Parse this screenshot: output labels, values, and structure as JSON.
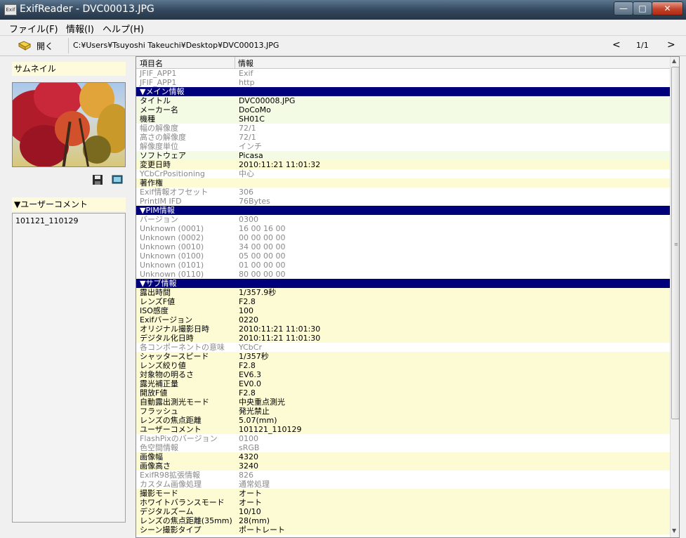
{
  "window": {
    "app_icon": "Exif",
    "title": "ExifReader - DVC00013.JPG",
    "controls": {
      "minimize": "—",
      "maximize": "□",
      "close": "✕"
    }
  },
  "menu": [
    "ファイル(F)",
    "情報(I)",
    "ヘルプ(H)"
  ],
  "toolbar": {
    "open_label": "開く",
    "open_icon": "open-icon",
    "path": "C:¥Users¥Tsuyoshi Takeuchi¥Desktop¥DVC00013.JPG",
    "prev": "<",
    "page": "1/1",
    "next": ">"
  },
  "left": {
    "thumbnail_label": "サムネイル",
    "user_comment_label": "▼ユーザーコメント",
    "user_comment": "101121_110129",
    "icons": [
      "save-icon",
      "monitor-icon"
    ]
  },
  "grid": {
    "header": {
      "col1": "項目名",
      "col2": "情報"
    },
    "rows": [
      {
        "k": "JFIF_APP1",
        "v": "Exif",
        "s": "g"
      },
      {
        "k": "JFIF_APP1",
        "v": "http",
        "s": "g"
      },
      {
        "k": "▼メイン情報",
        "v": "",
        "s": "h"
      },
      {
        "k": "タイトル",
        "v": "DVC00008.JPG",
        "s": "n"
      },
      {
        "k": "メーカー名",
        "v": "DoCoMo",
        "s": "n"
      },
      {
        "k": "機種",
        "v": "SH01C",
        "s": "n"
      },
      {
        "k": "幅の解像度",
        "v": "72/1",
        "s": "g"
      },
      {
        "k": "高さの解像度",
        "v": "72/1",
        "s": "g"
      },
      {
        "k": "解像度単位",
        "v": "インチ",
        "s": "g"
      },
      {
        "k": "ソフトウェア",
        "v": "Picasa",
        "s": "n"
      },
      {
        "k": "変更日時",
        "v": "2010:11:21 11:01:32",
        "s": "y"
      },
      {
        "k": "YCbCrPositioning",
        "v": "中心",
        "s": "g"
      },
      {
        "k": "著作権",
        "v": "",
        "s": "y"
      },
      {
        "k": "Exif情報オフセット",
        "v": "306",
        "s": "g"
      },
      {
        "k": "PrintIM IFD",
        "v": "76Bytes",
        "s": "g"
      },
      {
        "k": "▼PIM情報",
        "v": "",
        "s": "h"
      },
      {
        "k": "バージョン",
        "v": "0300",
        "s": "g"
      },
      {
        "k": "Unknown (0001)",
        "v": "16 00 16 00",
        "s": "g"
      },
      {
        "k": "Unknown (0002)",
        "v": "00 00 00 00",
        "s": "g"
      },
      {
        "k": "Unknown (0010)",
        "v": "34 00 00 00",
        "s": "g"
      },
      {
        "k": "Unknown (0100)",
        "v": "05 00 00 00",
        "s": "g"
      },
      {
        "k": "Unknown (0101)",
        "v": "01 00 00 00",
        "s": "g"
      },
      {
        "k": "Unknown (0110)",
        "v": "80 00 00 00",
        "s": "g"
      },
      {
        "k": "▼サブ情報",
        "v": "",
        "s": "h"
      },
      {
        "k": "露出時間",
        "v": "1/357.9秒",
        "s": "y"
      },
      {
        "k": "レンズF値",
        "v": "F2.8",
        "s": "y"
      },
      {
        "k": "ISO感度",
        "v": "100",
        "s": "y"
      },
      {
        "k": "Exifバージョン",
        "v": "0220",
        "s": "y"
      },
      {
        "k": "オリジナル撮影日時",
        "v": "2010:11:21 11:01:30",
        "s": "y"
      },
      {
        "k": "デジタル化日時",
        "v": "2010:11:21 11:01:30",
        "s": "y"
      },
      {
        "k": "各コンポーネントの意味",
        "v": "YCbCr",
        "s": "g"
      },
      {
        "k": "シャッタースピード",
        "v": "1/357秒",
        "s": "y"
      },
      {
        "k": "レンズ絞り値",
        "v": "F2.8",
        "s": "y"
      },
      {
        "k": "対象物の明るさ",
        "v": "EV6.3",
        "s": "y"
      },
      {
        "k": "露光補正量",
        "v": "EV0.0",
        "s": "y"
      },
      {
        "k": "開放F値",
        "v": "F2.8",
        "s": "y"
      },
      {
        "k": "自動露出測光モード",
        "v": "中央重点測光",
        "s": "y"
      },
      {
        "k": "フラッシュ",
        "v": "発光禁止",
        "s": "y"
      },
      {
        "k": "レンズの焦点距離",
        "v": "5.07(mm)",
        "s": "y"
      },
      {
        "k": "ユーザーコメント",
        "v": "101121_110129",
        "s": "y"
      },
      {
        "k": "FlashPixのバージョン",
        "v": "0100",
        "s": "g"
      },
      {
        "k": "色空間情報",
        "v": "sRGB",
        "s": "g"
      },
      {
        "k": "画像幅",
        "v": "4320",
        "s": "y"
      },
      {
        "k": "画像高さ",
        "v": "3240",
        "s": "y"
      },
      {
        "k": "ExifR98拡張情報",
        "v": "826",
        "s": "g"
      },
      {
        "k": "カスタム画像処理",
        "v": "通常処理",
        "s": "g"
      },
      {
        "k": "撮影モード",
        "v": "オート",
        "s": "y"
      },
      {
        "k": "ホワイトバランスモード",
        "v": "オート",
        "s": "y"
      },
      {
        "k": "デジタルズーム",
        "v": "10/10",
        "s": "y"
      },
      {
        "k": "レンズの焦点距離(35mm)",
        "v": "28(mm)",
        "s": "y"
      },
      {
        "k": "シーン撮影タイプ",
        "v": "ポートレート",
        "s": "y"
      }
    ]
  },
  "scrollbar": {
    "up": "▲",
    "down": "▼",
    "grip": "≡"
  }
}
